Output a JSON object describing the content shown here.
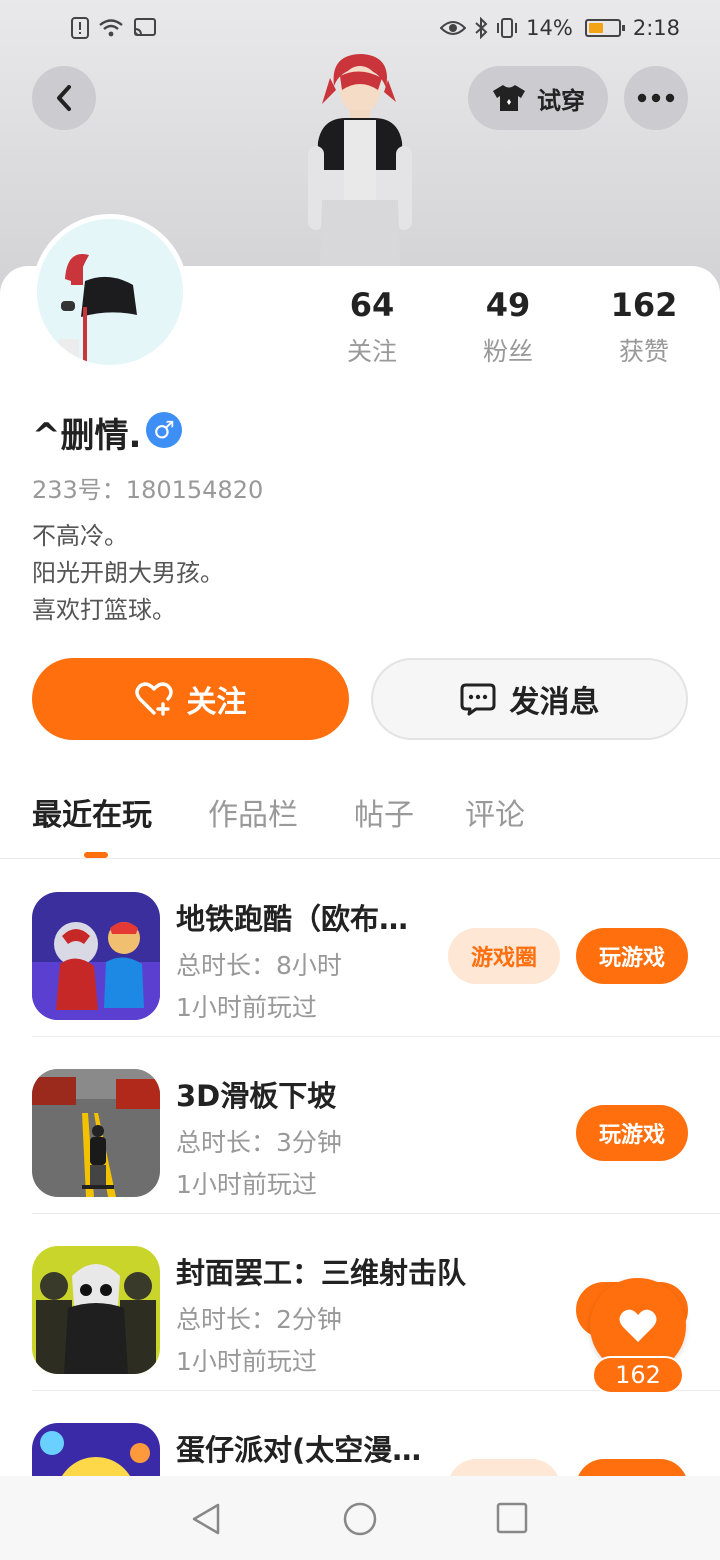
{
  "status_bar": {
    "battery_percent": "14%",
    "time": "2:18",
    "battery_level": 0.14
  },
  "header": {
    "try_on_label": "试穿",
    "back_icon": "back-arrow-icon",
    "more_icon": "more-dots-icon"
  },
  "profile": {
    "stats": [
      {
        "value": "64",
        "label": "关注"
      },
      {
        "value": "49",
        "label": "粉丝"
      },
      {
        "value": "162",
        "label": "获赞"
      }
    ],
    "username": "^删情.",
    "gender_symbol": "♂",
    "id_line": "233号：180154820",
    "bio": [
      "不高冷。",
      "阳光开朗大男孩。",
      "喜欢打篮球。"
    ],
    "gender_color": "#3d8ef5"
  },
  "actions": {
    "follow_label": "关注",
    "message_label": "发消息",
    "accent_color": "#ff6f0e"
  },
  "tabs": [
    {
      "label": "最近在玩",
      "active": true
    },
    {
      "label": "作品栏",
      "active": false
    },
    {
      "label": "帖子",
      "active": false
    },
    {
      "label": "评论",
      "active": false
    }
  ],
  "games": [
    {
      "title": "地铁跑酷（欧布奥特曼）",
      "duration": "总时长：8小时",
      "last_played": "1小时前玩过",
      "circle_label": "游戏圈",
      "play_label": "玩游戏"
    },
    {
      "title": "3D滑板下坡",
      "duration": "总时长：3分钟",
      "last_played": "1小时前玩过",
      "play_label": "玩游戏"
    },
    {
      "title": "封面罢工：三维射击队",
      "duration": "总时长：2分钟",
      "last_played": "1小时前玩过",
      "play_label": "玩游戏"
    },
    {
      "title": "蛋仔派对(太空漫游)"
    }
  ],
  "like_fab": {
    "count": "162"
  }
}
